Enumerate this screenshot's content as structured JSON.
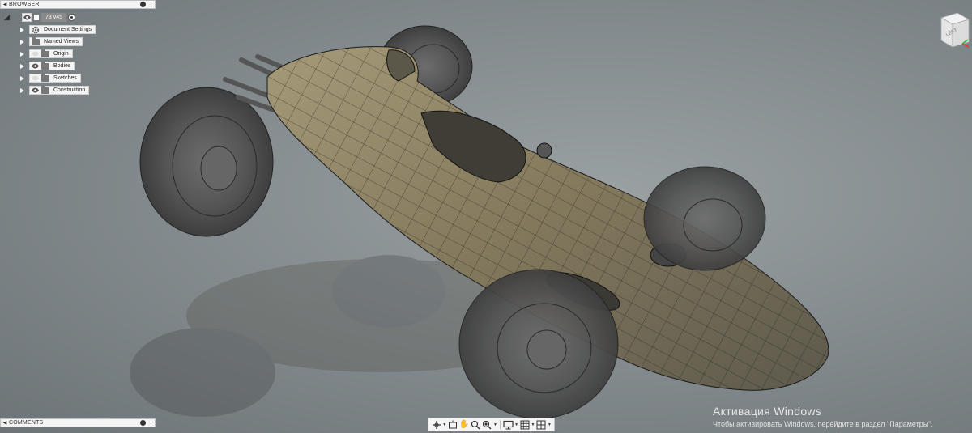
{
  "browser": {
    "title": "BROWSER",
    "root": {
      "name": "73 v45"
    },
    "items": [
      {
        "label": "Document Settings",
        "icon": "gear-icon",
        "visible": null
      },
      {
        "label": "Named Views",
        "icon": "folder-icon",
        "visible": null
      },
      {
        "label": "Origin",
        "icon": "folder-icon",
        "visible": false
      },
      {
        "label": "Bodies",
        "icon": "folder-icon",
        "visible": true
      },
      {
        "label": "Sketches",
        "icon": "folder-icon",
        "visible": false
      },
      {
        "label": "Construction",
        "icon": "folder-icon",
        "visible": true
      }
    ]
  },
  "comments": {
    "title": "COMMENTS"
  },
  "viewcube": {
    "face_label": "LEFT"
  },
  "toolbar": {
    "icons": [
      "orbit-icon",
      "look-at-icon",
      "pan-icon",
      "zoom-icon",
      "fit-icon",
      "display-settings-icon",
      "grid-icon",
      "viewports-icon"
    ]
  },
  "watermark": {
    "title": "Активация Windows",
    "subtitle": "Чтобы активировать Windows, перейдите в раздел \"Параметры\"."
  },
  "colors": {
    "viewport_bg": "#868d90",
    "panel_bg": "#f4f4f4",
    "body_tan": "#8f8466",
    "mesh_line": "#1a1a1a"
  }
}
